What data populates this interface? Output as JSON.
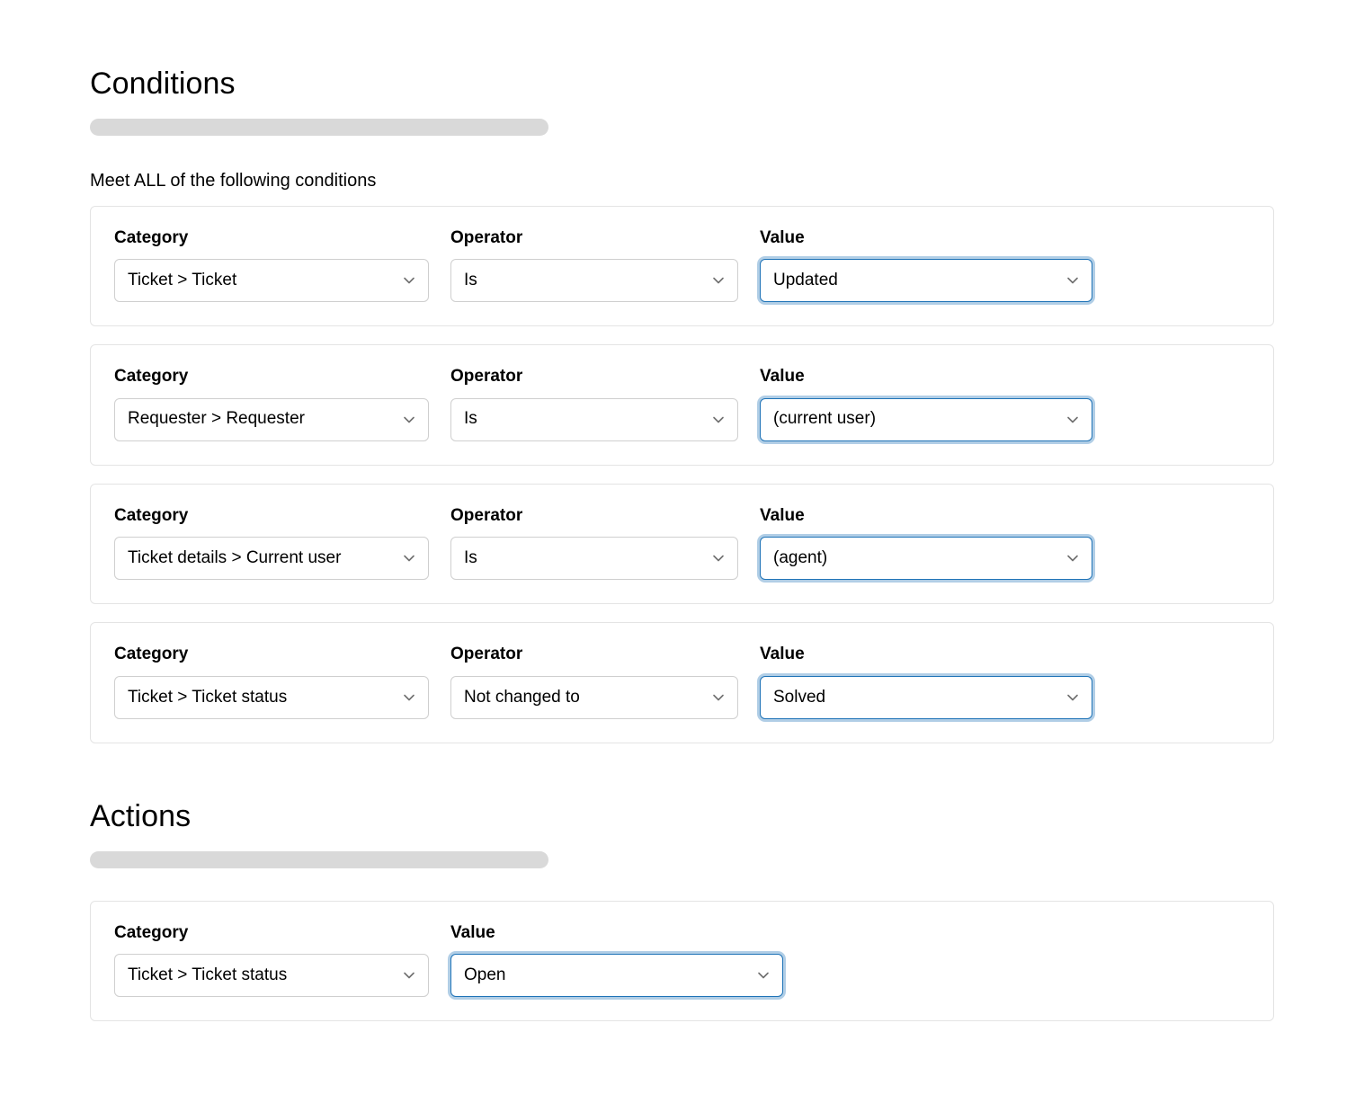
{
  "labels": {
    "category": "Category",
    "operator": "Operator",
    "value": "Value"
  },
  "conditions_section": {
    "title": "Conditions",
    "subheading": "Meet ALL of the following conditions",
    "rows": [
      {
        "category": "Ticket > Ticket",
        "operator": "Is",
        "value": "Updated"
      },
      {
        "category": "Requester > Requester",
        "operator": "Is",
        "value": "(current user)"
      },
      {
        "category": "Ticket details > Current user",
        "operator": "Is",
        "value": "(agent)"
      },
      {
        "category": "Ticket > Ticket status",
        "operator": "Not changed to",
        "value": "Solved"
      }
    ]
  },
  "actions_section": {
    "title": "Actions",
    "rows": [
      {
        "category": "Ticket > Ticket status",
        "value": "Open"
      }
    ]
  }
}
